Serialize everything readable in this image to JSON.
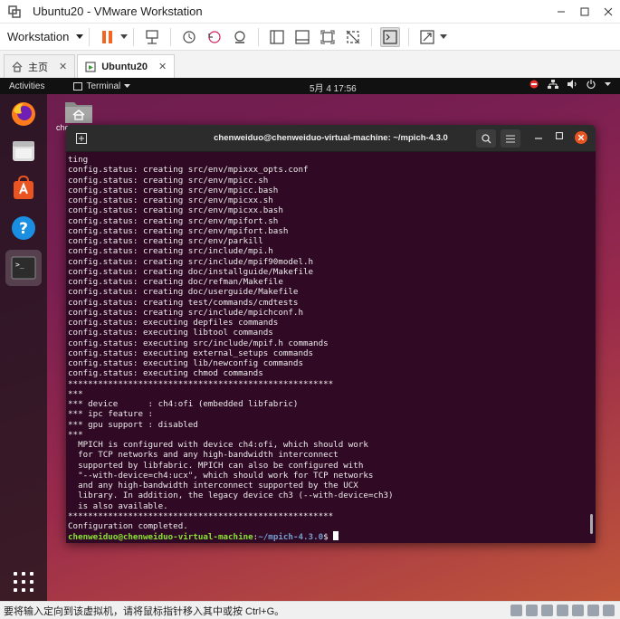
{
  "window": {
    "title": "Ubuntu20 - VMware Workstation"
  },
  "toolbar": {
    "menu_label": "Workstation"
  },
  "tabs": [
    {
      "label": "主页"
    },
    {
      "label": "Ubuntu20"
    }
  ],
  "ubuntu": {
    "activities": "Activities",
    "app_menu": "Terminal",
    "clock": "5月 4  17:56"
  },
  "terminal": {
    "title": "chenweiduo@chenweiduo-virtual-machine: ~/mpich-4.3.0",
    "lines": [
      "ting",
      "config.status: creating src/env/mpixxx_opts.conf",
      "config.status: creating src/env/mpicc.sh",
      "config.status: creating src/env/mpicc.bash",
      "config.status: creating src/env/mpicxx.sh",
      "config.status: creating src/env/mpicxx.bash",
      "config.status: creating src/env/mpifort.sh",
      "config.status: creating src/env/mpifort.bash",
      "config.status: creating src/env/parkill",
      "config.status: creating src/include/mpi.h",
      "config.status: creating src/include/mpif90model.h",
      "config.status: creating doc/installguide/Makefile",
      "config.status: creating doc/refman/Makefile",
      "config.status: creating doc/userguide/Makefile",
      "config.status: creating test/commands/cmdtests",
      "config.status: creating src/include/mpichconf.h",
      "config.status: executing depfiles commands",
      "config.status: executing libtool commands",
      "config.status: executing src/include/mpif.h commands",
      "config.status: executing external_setups commands",
      "config.status: executing lib/newconfig commands",
      "config.status: executing chmod commands",
      "*****************************************************",
      "***",
      "*** device      : ch4:ofi (embedded libfabric)",
      "*** ipc feature :",
      "*** gpu support : disabled",
      "***",
      "  MPICH is configured with device ch4:ofi, which should work",
      "  for TCP networks and any high-bandwidth interconnect",
      "  supported by libfabric. MPICH can also be configured with",
      "  \"--with-device=ch4:ucx\", which should work for TCP networks",
      "  and any high-bandwidth interconnect supported by the UCX",
      "  library. In addition, the legacy device ch3 (--with-device=ch3)",
      "  is also available.",
      "*****************************************************",
      "Configuration completed."
    ],
    "prompt_user": "chenweiduo@chenweiduo-virtual-machine",
    "prompt_colon": ":",
    "prompt_path": "~/mpich-4.3.0",
    "prompt_symbol": "$ "
  },
  "desktop": {
    "home_label": "che"
  },
  "status": {
    "message": "要将输入定向到该虚拟机，请将鼠标指针移入其中或按 Ctrl+G。"
  },
  "colors": {
    "terminal_bg": "#300a24",
    "ubuntu_orange": "#e95420",
    "prompt_user": "#8ae234",
    "prompt_path": "#729fcf",
    "vmware_accent": "#f26522"
  }
}
